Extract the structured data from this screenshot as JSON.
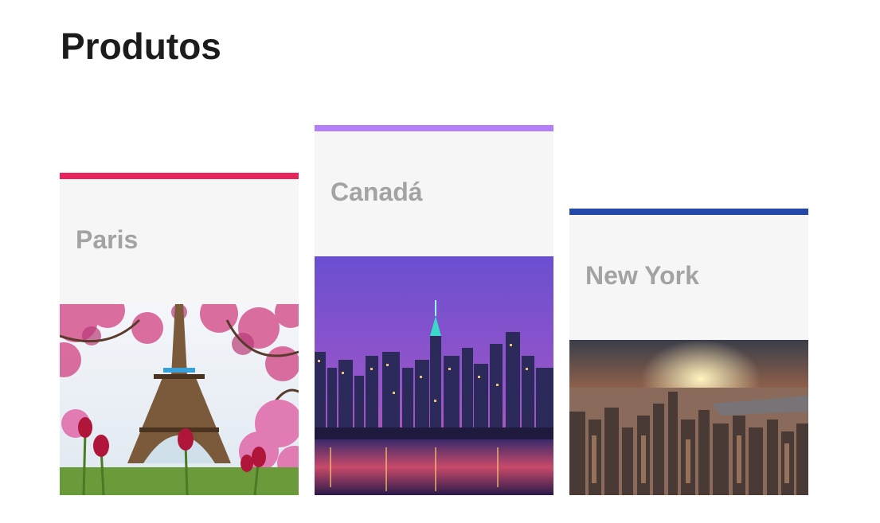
{
  "page": {
    "title": "Produtos"
  },
  "cards": [
    {
      "id": "paris",
      "title": "Paris",
      "accent": "#e8245c",
      "image_icon": "eiffel-tower-photo"
    },
    {
      "id": "canada",
      "title": "Canadá",
      "accent": "#b57ff7",
      "image_icon": "city-skyline-night-photo"
    },
    {
      "id": "new-york",
      "title": "New York",
      "accent": "#2448a8",
      "image_icon": "new-york-sunset-photo"
    }
  ]
}
